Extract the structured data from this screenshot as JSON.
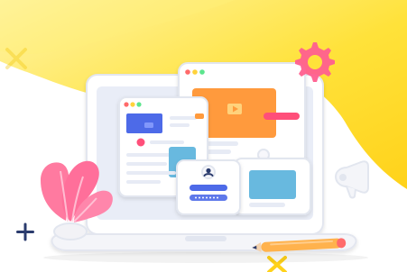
{
  "illustration": {
    "colors": {
      "background": "#ffffff",
      "yellow_blob": "#ffe23a",
      "yellow_soft": "#fff07a",
      "laptop_body": "#f3f4f8",
      "laptop_bezel": "#ffffff",
      "screen": "#e9edf7",
      "window_bg": "#f7f7fb",
      "window_border": "#dfe2ea",
      "blue_card": "#4d6ae8",
      "orange_card": "#ff9a3d",
      "pink": "#ff4f7a",
      "teal": "#67b9df",
      "plant": "#ff7aa0",
      "pot": "#f2f2f6",
      "gear": "#ff5f8f",
      "pencil_body": "#ffb24d",
      "pencil_tip": "#ff6b6b",
      "navy": "#2a3b6d"
    },
    "icons": [
      "gear-icon",
      "megaphone-icon",
      "play-icon",
      "user-avatar-icon",
      "plus-icon",
      "x-icon",
      "plant-icon",
      "pencil-icon"
    ]
  }
}
